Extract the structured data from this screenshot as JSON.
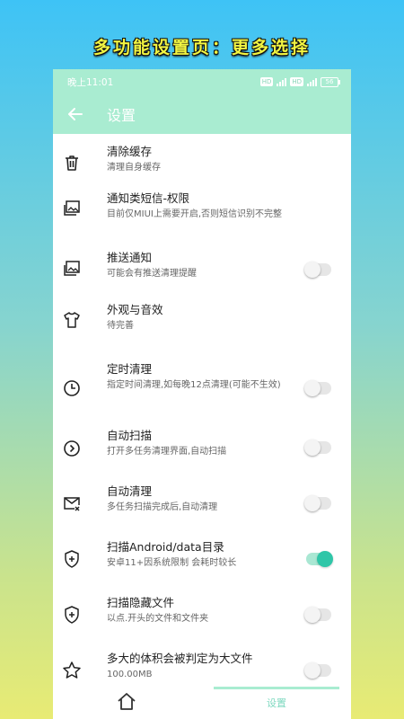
{
  "banner": "多功能设置页：更多选择",
  "status": {
    "time": "晚上11:01",
    "mini1": "HD",
    "mini2": "HD",
    "battery": "56"
  },
  "toolbar": {
    "title": "设置"
  },
  "items": [
    {
      "title": "清除缓存",
      "subtitle": "清理自身缓存",
      "icon": "trash-icon"
    },
    {
      "title": "通知类短信-权限",
      "subtitle": "目前仅MIUI上需要开启,否则短信识别不完整",
      "icon": "image-stack-icon"
    },
    {
      "title": "推送通知",
      "subtitle": "可能会有推送清理提醒",
      "icon": "image-stack-icon",
      "toggle": false
    },
    {
      "title": "外观与音效",
      "subtitle": "待完善",
      "icon": "shirt-icon"
    },
    {
      "title": "定时清理",
      "subtitle": "指定时间清理,如每晚12点清理(可能不生效)",
      "icon": "clock-icon",
      "toggle": false
    },
    {
      "title": "自动扫描",
      "subtitle": "打开多任务清理界面,自动扫描",
      "icon": "circle-chevron-icon",
      "toggle": false
    },
    {
      "title": "自动清理",
      "subtitle": "多任务扫描完成后,自动清理",
      "icon": "mail-x-icon",
      "toggle": false
    },
    {
      "title": "扫描Android/data目录",
      "subtitle": "安卓11+因系统限制 会耗时较长",
      "icon": "shield-plus-icon",
      "toggle": true
    },
    {
      "title": "扫描隐藏文件",
      "subtitle": "以点.开头的文件和文件夹",
      "icon": "shield-plus-icon",
      "toggle": false
    },
    {
      "title": "多大的体积会被判定为大文件",
      "subtitle": "100.00MB",
      "icon": "star-icon",
      "toggle": false
    }
  ],
  "nav": {
    "settings_label": "设置"
  },
  "colors": {
    "accent": "#a9ecd1",
    "toggle_on": "#2fc6a8"
  }
}
